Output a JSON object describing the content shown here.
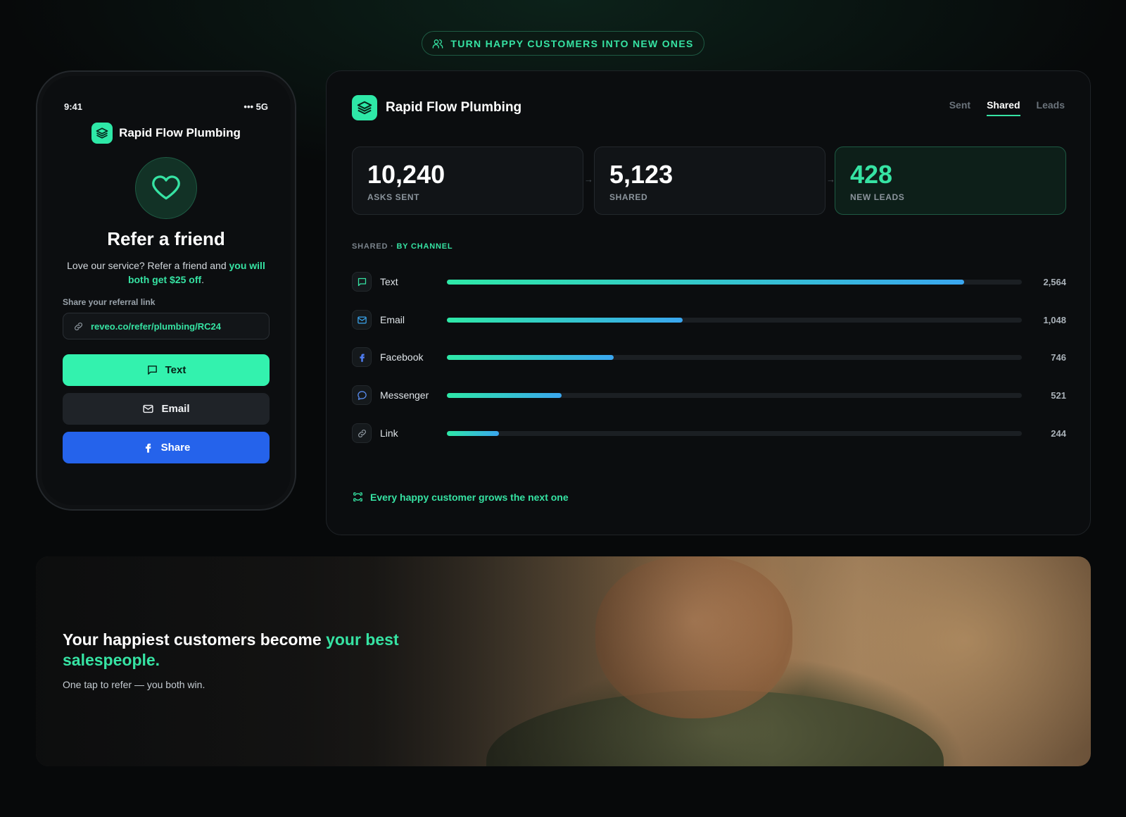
{
  "banner_pill": {
    "text": "TURN HAPPY CUSTOMERS INTO NEW ONES",
    "icon": "users-icon"
  },
  "phone": {
    "status": {
      "time": "9:41",
      "signal": "••• 5G"
    },
    "brand": "Rapid Flow Plumbing",
    "title": "Refer a friend",
    "desc_plain": "Love our service? Refer a friend and ",
    "desc_highlight": "you will both get $25 off",
    "desc_end": ".",
    "link_label": "Share your referral link",
    "link_url": "reveo.co/refer/plumbing/RC24",
    "buttons": {
      "text": "Text",
      "email": "Email",
      "share": "Share"
    }
  },
  "dashboard": {
    "brand": "Rapid Flow Plumbing",
    "tabs": [
      {
        "label": "Sent",
        "active": false
      },
      {
        "label": "Shared",
        "active": true
      },
      {
        "label": "Leads",
        "active": false
      }
    ],
    "stats": [
      {
        "value": "10,240",
        "label": "ASKS SENT"
      },
      {
        "value": "5,123",
        "label": "SHARED"
      },
      {
        "value": "428",
        "label": "NEW LEADS"
      }
    ],
    "section_prefix": "SHARED · ",
    "section_highlight": "BY CHANNEL",
    "channels": [
      {
        "name": "Text",
        "value": "2,564",
        "fraction": 0.9,
        "icon": "message-square-icon"
      },
      {
        "name": "Email",
        "value": "1,048",
        "fraction": 0.41,
        "icon": "mail-icon"
      },
      {
        "name": "Facebook",
        "value": "746",
        "fraction": 0.29,
        "icon": "facebook-icon"
      },
      {
        "name": "Messenger",
        "value": "521",
        "fraction": 0.2,
        "icon": "message-circle-icon"
      },
      {
        "name": "Link",
        "value": "244",
        "fraction": 0.09,
        "icon": "link-icon"
      }
    ],
    "footer": "Every happy customer grows the next one"
  },
  "hero": {
    "title_plain": "Your happiest customers become ",
    "title_highlight": "your best salespeople.",
    "subtitle": "One tap to refer — you both win."
  },
  "colors": {
    "accent": "#36e3a3",
    "share_blue": "#2563eb",
    "background": "#07090a"
  }
}
